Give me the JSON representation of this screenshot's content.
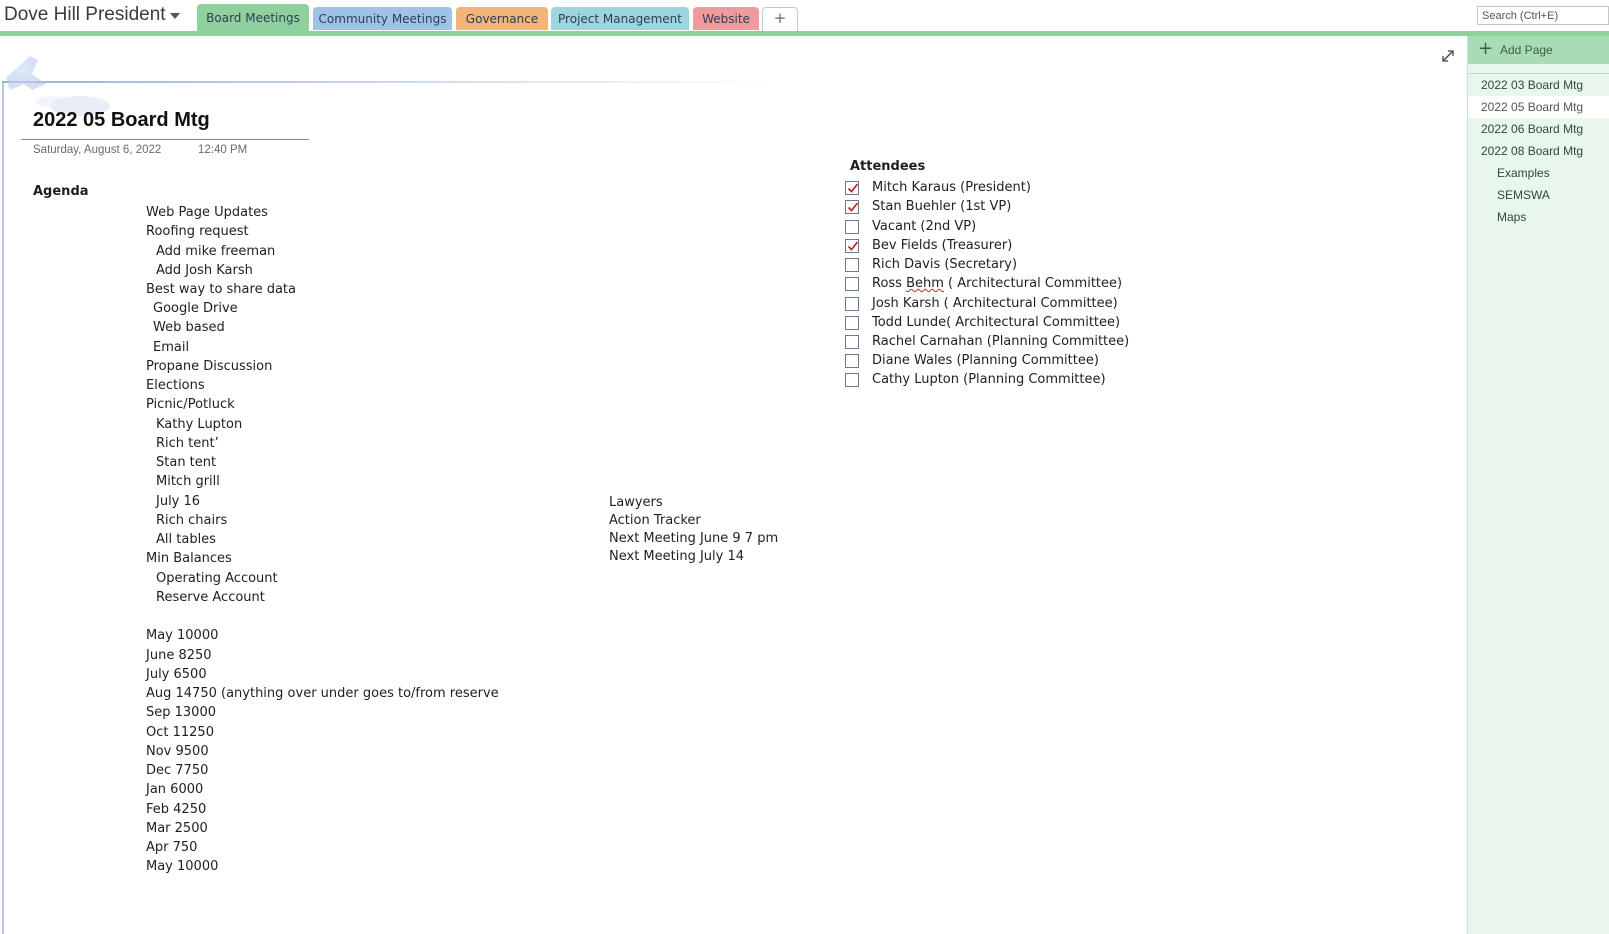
{
  "notebook": {
    "title": "Dove Hill President"
  },
  "tabs": [
    {
      "label": "Board Meetings",
      "color": "#8fd19e",
      "active": true
    },
    {
      "label": "Community Meetings",
      "color": "#9ec3e6",
      "active": false
    },
    {
      "label": "Governance",
      "color": "#f3b47a",
      "active": false
    },
    {
      "label": "Project Management",
      "color": "#9ed5dc",
      "active": false
    },
    {
      "label": "Website",
      "color": "#f19a9e",
      "active": false
    }
  ],
  "add_tab_label": "+",
  "search": {
    "placeholder": "Search (Ctrl+E)"
  },
  "page": {
    "title": "2022 05 Board Mtg",
    "date": "Saturday, August 6, 2022",
    "time": "12:40 PM"
  },
  "agenda": {
    "heading": "Agenda",
    "items": [
      {
        "text": "Web Page Updates",
        "indent": 0
      },
      {
        "text": "Roofing request",
        "indent": 0
      },
      {
        "text": "Add mike freeman",
        "indent": 2
      },
      {
        "text": "Add Josh Karsh",
        "indent": 2
      },
      {
        "text": "Best way to share data",
        "indent": 0
      },
      {
        "text": "Google Drive",
        "indent": 1
      },
      {
        "text": "Web based",
        "indent": 1
      },
      {
        "text": "Email",
        "indent": 1
      },
      {
        "text": "Propane Discussion",
        "indent": 0
      },
      {
        "text": "Elections",
        "indent": 0
      },
      {
        "text": "Picnic/Potluck",
        "indent": 0
      },
      {
        "text": "Kathy Lupton",
        "indent": 2
      },
      {
        "text": "Rich tent’",
        "indent": 2
      },
      {
        "text": "Stan tent",
        "indent": 2
      },
      {
        "text": "Mitch grill",
        "indent": 2
      },
      {
        "text": "July 16",
        "indent": 2
      },
      {
        "text": "Rich chairs",
        "indent": 2
      },
      {
        "text": "All tables",
        "indent": 2
      },
      {
        "text": "Min Balances",
        "indent": 0
      },
      {
        "text": "Operating Account",
        "indent": 2
      },
      {
        "text": "Reserve Account",
        "indent": 2
      }
    ],
    "balances": [
      "May 10000",
      "June 8250",
      "July 6500",
      "Aug 14750 (anything over under goes to/from reserve",
      "Sep 13000",
      "Oct 11250",
      "Nov 9500",
      "Dec 7750",
      "Jan 6000",
      "Feb 4250",
      "Mar 2500",
      "Apr 750",
      "May 10000"
    ]
  },
  "other_items": [
    "Lawyers",
    "Action Tracker",
    "Next Meeting June 9 7 pm",
    "Next Meeting July 14"
  ],
  "attendees": {
    "heading": "Attendees",
    "items": [
      {
        "name": "Mitch Karaus (President)",
        "checked": true
      },
      {
        "name": "Stan Buehler (1st VP)",
        "checked": true
      },
      {
        "name": "Vacant (2nd VP)",
        "checked": false
      },
      {
        "name": "Bev Fields (Treasurer)",
        "checked": true
      },
      {
        "name": "Rich Davis (Secretary)",
        "checked": false
      },
      {
        "name_prefix": "Ross ",
        "name_flagged": "Behm",
        "name_suffix": " ( Architectural Committee)",
        "checked": false
      },
      {
        "name": "Josh Karsh ( Architectural Committee)",
        "checked": false
      },
      {
        "name": "Todd Lunde( Architectural Committee)",
        "checked": false
      },
      {
        "name": "Rachel Carnahan (Planning Committee)",
        "checked": false
      },
      {
        "name": "Diane Wales (Planning Committee)",
        "checked": false
      },
      {
        "name": "Cathy Lupton (Planning Committee)",
        "checked": false
      }
    ]
  },
  "page_list": {
    "add_page_label": "Add Page",
    "items": [
      {
        "label": "2022 03 Board Mtg",
        "level": 0,
        "selected": false
      },
      {
        "label": "2022 05 Board Mtg",
        "level": 0,
        "selected": true
      },
      {
        "label": "2022 06 Board Mtg",
        "level": 0,
        "selected": false
      },
      {
        "label": "2022 08 Board Mtg",
        "level": 0,
        "selected": false
      },
      {
        "label": "Examples",
        "level": 1,
        "selected": false
      },
      {
        "label": "SEMSWA",
        "level": 1,
        "selected": false
      },
      {
        "label": "Maps",
        "level": 1,
        "selected": false
      }
    ]
  },
  "icons": {
    "expand": "expand-icon",
    "add_page": "plus-icon",
    "checkbox_checked": "checkmark-icon",
    "notebook_dropdown": "chevron-down-icon",
    "pushpin": "pushpin-icon"
  },
  "colors": {
    "active_section": "#8fd19e",
    "page_list_bg": "#e9f6ec",
    "checkmark": "#c0282d"
  }
}
